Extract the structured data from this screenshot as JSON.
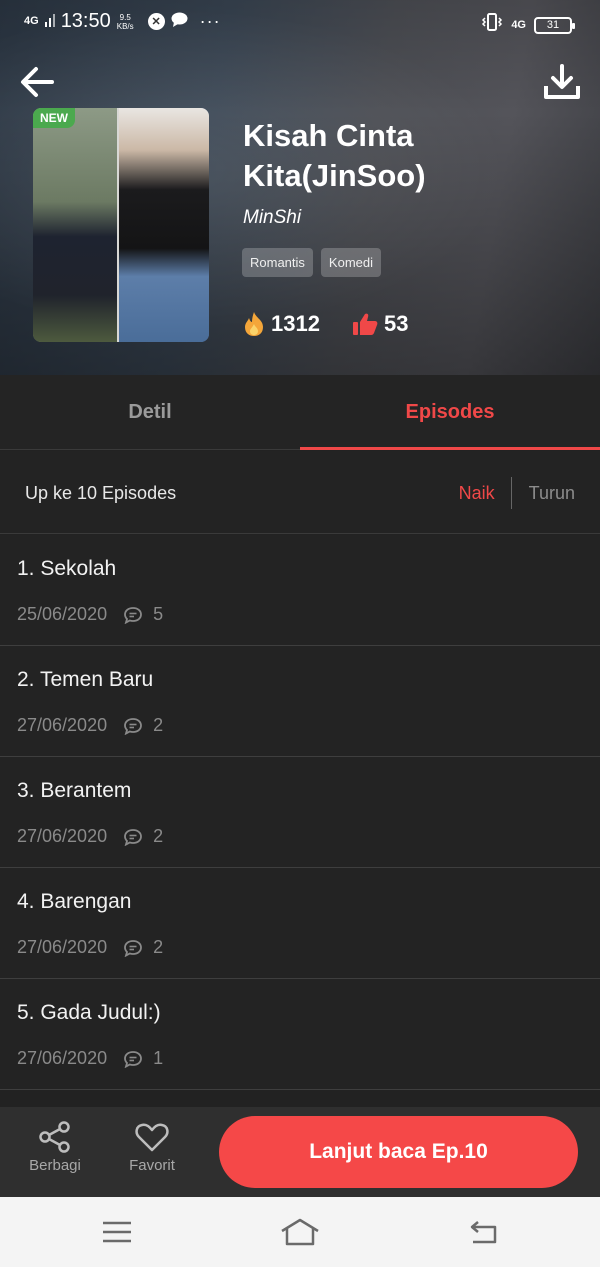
{
  "status_bar": {
    "network": "4G",
    "time": "13:50",
    "speed_value": "9.5",
    "speed_unit": "KB/s",
    "dots": "···",
    "right_network": "4G",
    "battery": "31"
  },
  "header": {
    "new_badge": "NEW",
    "title": "Kisah Cinta Kita(JinSoo)",
    "author": "MinShi",
    "tags": [
      "Romantis",
      "Komedi"
    ],
    "views": "1312",
    "likes": "53"
  },
  "tabs": [
    {
      "label": "Detil",
      "active": false
    },
    {
      "label": "Episodes",
      "active": true
    }
  ],
  "sort": {
    "count_text": "Up ke 10 Episodes",
    "asc_label": "Naik",
    "desc_label": "Turun"
  },
  "episodes": [
    {
      "title": "1. Sekolah",
      "date": "25/06/2020",
      "comments": "5"
    },
    {
      "title": "2. Temen Baru",
      "date": "27/06/2020",
      "comments": "2"
    },
    {
      "title": "3. Berantem",
      "date": "27/06/2020",
      "comments": "2"
    },
    {
      "title": "4. Barengan",
      "date": "27/06/2020",
      "comments": "2"
    },
    {
      "title": "5. Gada Judul:)",
      "date": "27/06/2020",
      "comments": "1"
    }
  ],
  "actions": {
    "share_label": "Berbagi",
    "favorite_label": "Favorit",
    "continue_label": "Lanjut baca Ep.10"
  },
  "colors": {
    "accent": "#f04848",
    "background": "#232323",
    "new_badge": "#4ba94e"
  }
}
